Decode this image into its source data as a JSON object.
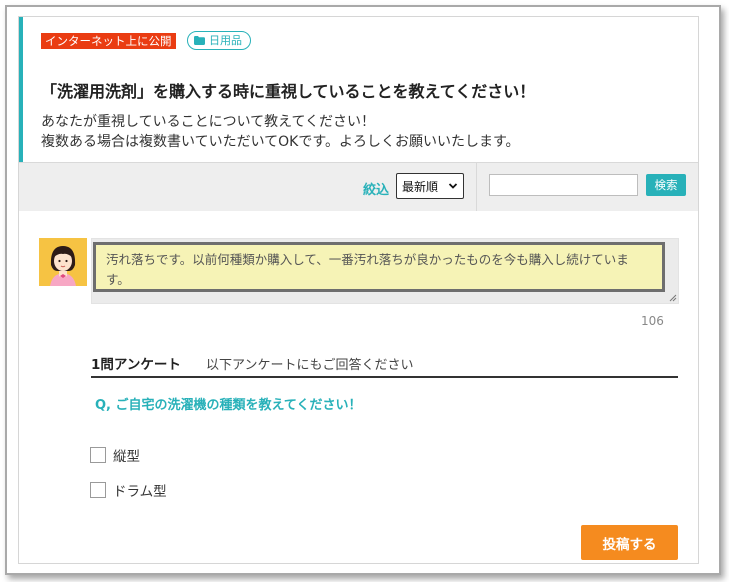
{
  "header": {
    "public_tag": "インターネット上に公開",
    "category": {
      "icon": "folder-icon",
      "label": "日用品"
    },
    "question_title": "「洗濯用洗剤」を購入する時に重視していることを教えてください！",
    "description_lines": [
      "あなたが重視していることについて教えてください！",
      "複数ある場合は複数書いていただいてOKです。よろしくお願いいたします。"
    ]
  },
  "toolbar": {
    "filter_label": "絞込",
    "sort_selected": "最新順",
    "search_value": "",
    "search_button": "検索"
  },
  "reply": {
    "avatar_icon": "woman-avatar-icon",
    "text": "汚れ落ちです。以前何種類か購入して、一番汚れ落ちが良かったものを今も購入し続けています。",
    "char_count": "106"
  },
  "survey": {
    "title": "1問アンケート",
    "subtitle": "以下アンケートにもご回答ください",
    "question": "Q, ご自宅の洗濯機の種類を教えてください！",
    "options": [
      "縦型",
      "ドラム型"
    ]
  },
  "actions": {
    "post_button": "投稿する"
  },
  "colors": {
    "accent": "#28b1b9",
    "public_tag": "#ea3c12",
    "post_button": "#f58b1f",
    "reply_bg": "#f6f3b6"
  }
}
